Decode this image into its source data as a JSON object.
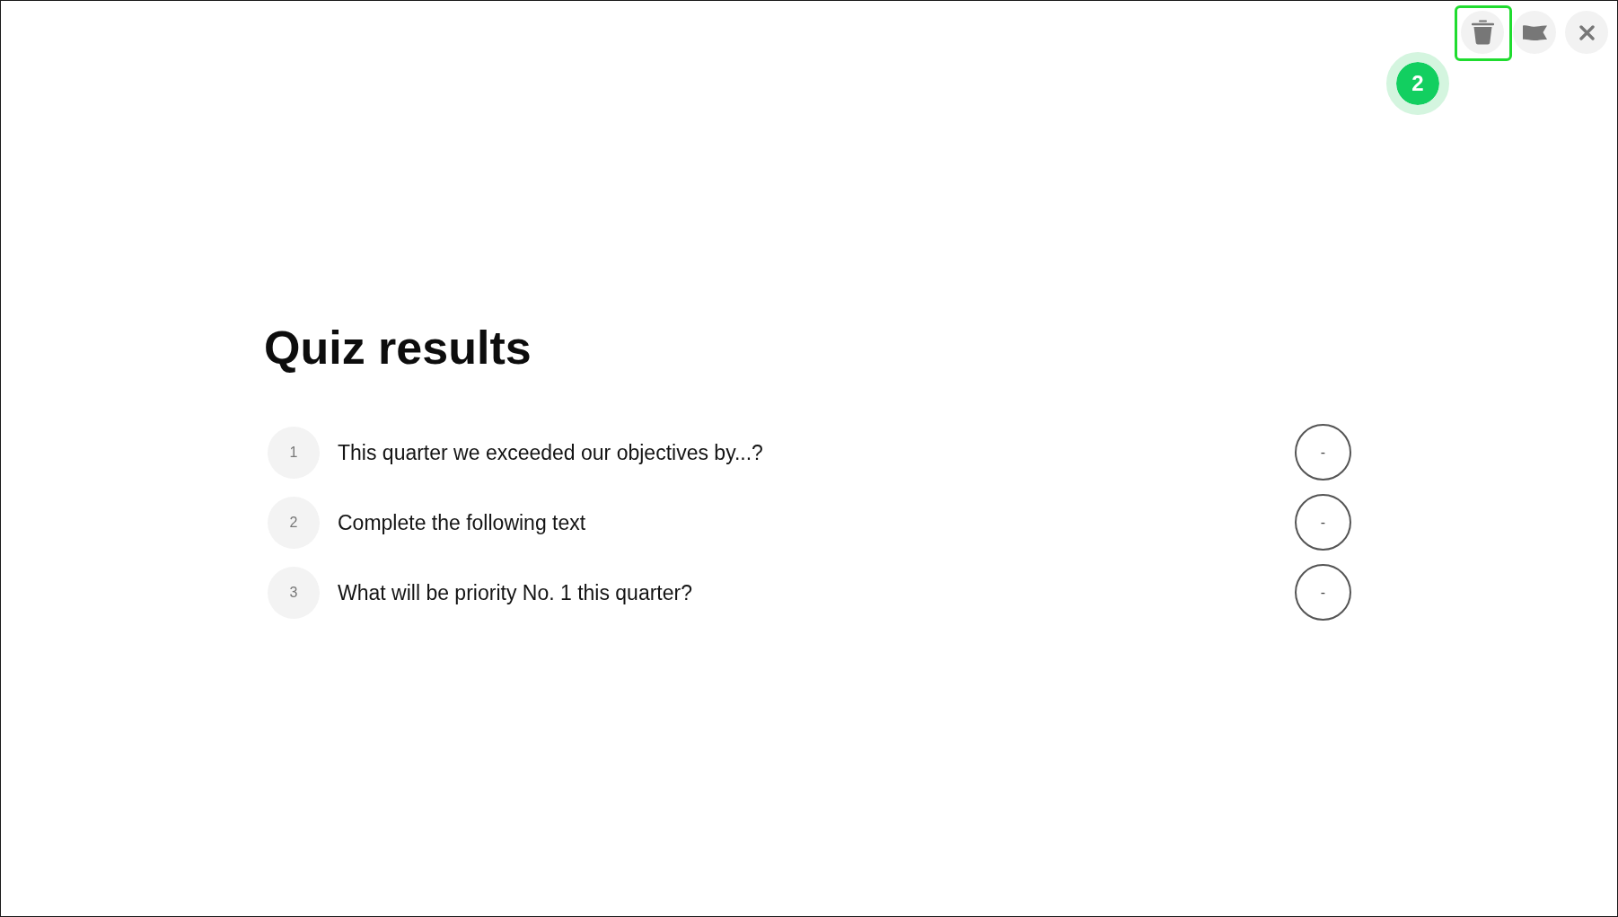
{
  "toolbar": {
    "buttons": [
      {
        "kind": "delete",
        "highlighted": true
      },
      {
        "kind": "flag",
        "highlighted": false
      },
      {
        "kind": "close",
        "highlighted": false
      }
    ]
  },
  "step_marker": "2",
  "title": "Quiz results",
  "questions": [
    {
      "number": "1",
      "text": "This quarter we exceeded our objectives by...?",
      "answer": "-"
    },
    {
      "number": "2",
      "text": "Complete the following text",
      "answer": "-"
    },
    {
      "number": "3",
      "text": "What will be priority No. 1 this quarter?",
      "answer": "-"
    }
  ]
}
